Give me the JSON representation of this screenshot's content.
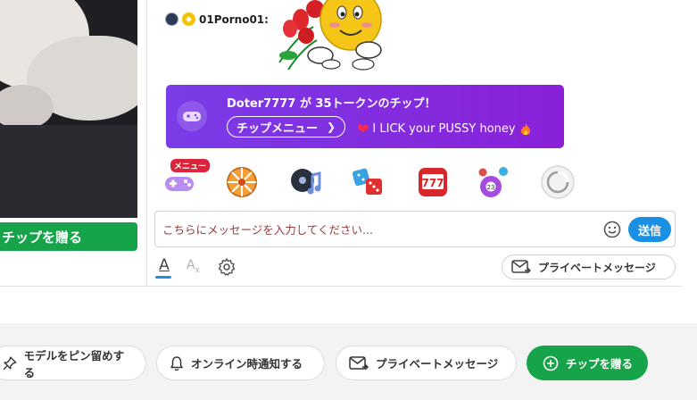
{
  "video": {
    "tip_button_label": "チップを贈る"
  },
  "chat": {
    "message": {
      "username": "01Porno01:"
    },
    "tip_banner": {
      "title": "Doter7777 が 35トークンのチップ！",
      "menu_label": "チップメニュー",
      "tip_message": "I LICK your PUSSY honey"
    },
    "icon_row": {
      "menu_badge": "メニュー",
      "icons": [
        "game-controller-icon",
        "wheel-of-fortune-icon",
        "music-disc-icon",
        "dice-icon",
        "slot-777-icon",
        "lottery-balls-icon",
        "swirl-icon"
      ]
    },
    "input": {
      "placeholder": "こちらにメッセージを入力してください...",
      "value": ""
    },
    "send_label": "送信",
    "tools": {
      "font_label": "A",
      "translate_label": "A",
      "private_message_label": "プライベートメッセージ"
    }
  },
  "bottom_bar": {
    "pin_label": "モデルをピン留めする",
    "notify_label": "オンライン時通知する",
    "private_message_label": "プライベートメッセージ",
    "tip_label": "チップを贈る"
  },
  "colors": {
    "tip_green": "#17a34a",
    "banner_purple": "#7a3ce8",
    "send_blue": "#1a8fe3"
  }
}
